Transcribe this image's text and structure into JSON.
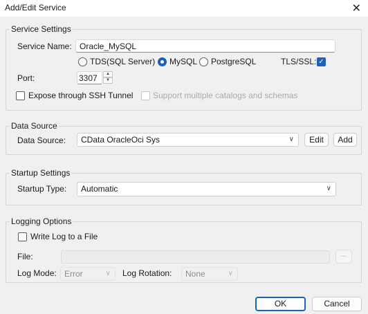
{
  "window": {
    "title": "Add/Edit Service",
    "close_glyph": "✕"
  },
  "service_settings": {
    "legend": "Service Settings",
    "name_label": "Service Name:",
    "name_value": "Oracle_MySQL",
    "radios": [
      {
        "label": "TDS(SQL Server)",
        "checked": false
      },
      {
        "label": "MySQL",
        "checked": true
      },
      {
        "label": "PostgreSQL",
        "checked": false
      }
    ],
    "tls_label": "TLS/SSL:",
    "tls_checked": true,
    "port_label": "Port:",
    "port_value": "3307",
    "ssh_label": "Expose through SSH Tunnel",
    "ssh_checked": false,
    "multi_label": "Support multiple catalogs and schemas",
    "multi_checked": false
  },
  "data_source": {
    "legend": "Data Source",
    "label": "Data Source:",
    "value": "CData OracleOci Sys",
    "edit_label": "Edit",
    "add_label": "Add"
  },
  "startup": {
    "legend": "Startup Settings",
    "label": "Startup Type:",
    "value": "Automatic"
  },
  "logging": {
    "legend": "Logging Options",
    "write_label": "Write Log to a File",
    "write_checked": false,
    "file_label": "File:",
    "file_value": "",
    "browse_label": "...",
    "mode_label": "Log Mode:",
    "mode_value": "Error",
    "rotation_label": "Log Rotation:",
    "rotation_value": "None"
  },
  "footer": {
    "ok_label": "OK",
    "cancel_label": "Cancel"
  },
  "colors": {
    "accent": "#1d5fba",
    "window_bg": "#f0f0f0",
    "border": "#d5d5d5"
  },
  "icons": {
    "close": "close-icon",
    "dropdown": "chevron-down-icon",
    "check": "checkmark-icon"
  }
}
